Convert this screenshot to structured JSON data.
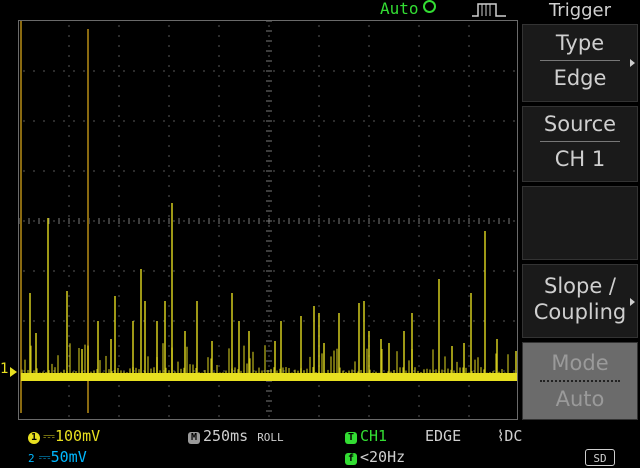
{
  "status": {
    "trigger_state": "Auto"
  },
  "menu": {
    "title": "Trigger",
    "type_label": "Type",
    "type_value": "Edge",
    "source_label": "Source",
    "source_value": "CH 1",
    "slope_label_1": "Slope /",
    "slope_label_2": "Coupling",
    "mode_label": "Mode",
    "mode_value": "Auto"
  },
  "markers": {
    "ch1": "1"
  },
  "bottom": {
    "ch1_scale": "100mV",
    "ch2_scale": "50mV",
    "ch1_badge": "1",
    "ch2_badge": "2",
    "timebase_badge": "M",
    "timebase": "250ms",
    "mode": "ROLL",
    "trig_badge": "T",
    "trig_source": "CH1",
    "trig_type": "EDGE",
    "trig_coupling": "DC",
    "freq_badge": "f",
    "freq": "<20Hz",
    "sd": "SD"
  },
  "colors": {
    "ch1": "#e8e020",
    "ch2": "#00b8ff",
    "trigger": "#33dd33",
    "cursor": "#8a6a10"
  },
  "icons": {
    "status": "circle-icon",
    "pulse": "pulse-icon",
    "storage": "sd-card-icon"
  }
}
